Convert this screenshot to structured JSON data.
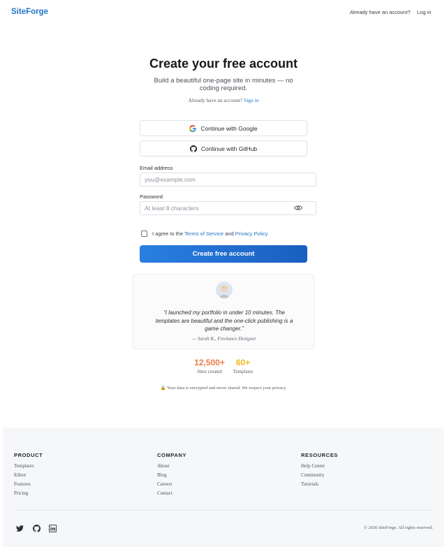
{
  "header": {
    "logo": "SiteForge",
    "already_text": "Already have an account?",
    "login_label": "Log in"
  },
  "hero": {
    "title": "Create your free account",
    "subtitle": "Build a beautiful one-page site in minutes — no coding required.",
    "signin_prompt": "Already have an account?",
    "signin_link": "Sign in"
  },
  "oauth": {
    "google_label": "Continue with Google",
    "github_label": "Continue with GitHub",
    "google_icon": "google-icon",
    "github_icon": "github-icon"
  },
  "form": {
    "email_label": "Email address",
    "email_placeholder": "you@example.com",
    "email_value": "",
    "password_label": "Password",
    "password_placeholder": "At least 8 characters",
    "password_value": "",
    "agree_prefix": "I agree to the",
    "terms_link": "Terms of Service",
    "agree_and": "and",
    "privacy_link": "Privacy Policy",
    "agree_checked": false,
    "submit_label": "Create free account"
  },
  "testimonial": {
    "quote": "“I launched my portfolio in under 10 minutes. The templates are beautiful and the one-click publishing is a game changer.”",
    "author": "— Sarah K., Freelance Designer"
  },
  "stats": [
    {
      "value": "12,500+",
      "label": "Sites created",
      "color": "#ef7b45"
    },
    {
      "value": "60+",
      "label": "Templates",
      "color": "#f0b81e"
    }
  ],
  "privacy_note": "Your data is encrypted and never shared. We respect your privacy.",
  "footer": {
    "columns": [
      {
        "heading": "PRODUCT",
        "links": [
          "Templates",
          "Editor",
          "Features",
          "Pricing"
        ]
      },
      {
        "heading": "COMPANY",
        "links": [
          "About",
          "Blog",
          "Careers",
          "Contact"
        ]
      },
      {
        "heading": "RESOURCES",
        "links": [
          "Help Center",
          "Community",
          "Tutorials"
        ]
      }
    ],
    "social": [
      "twitter-icon",
      "github-icon",
      "linkedin-icon"
    ],
    "copyright": "© 2026 SiteForge. All rights reserved."
  },
  "colors": {
    "brand": "#1f74c8",
    "cta_start": "#2a7fe0",
    "cta_end": "#1a5fc0"
  }
}
